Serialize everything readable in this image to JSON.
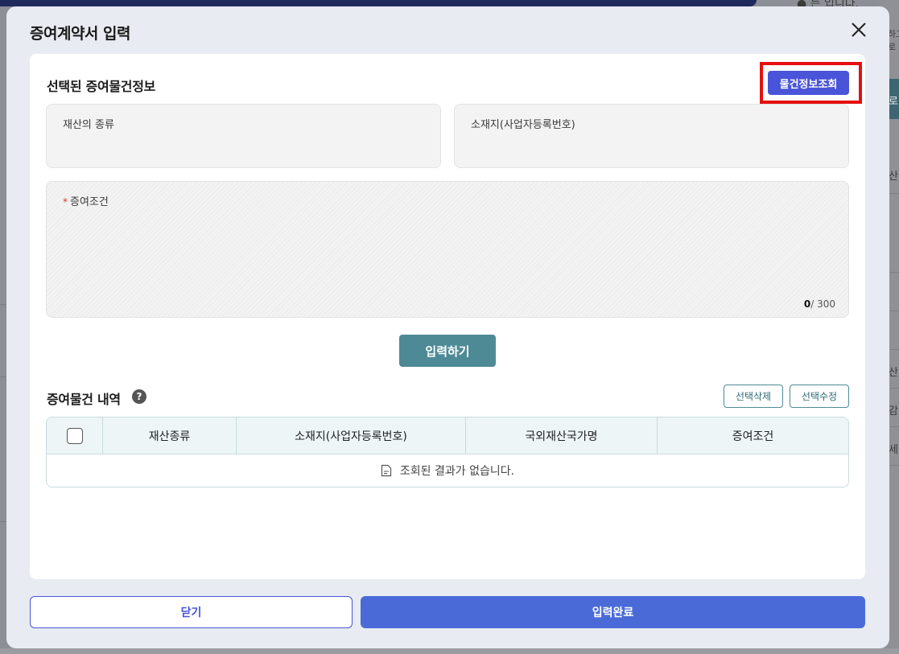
{
  "background": {
    "fragments": [
      "● 는 입니다.",
      "하고",
      "로",
      "로",
      "산",
      "산",
      "감",
      "세"
    ]
  },
  "modal": {
    "title": "증여계약서 입력",
    "section_title": "선택된 증여물건정보",
    "lookup_button": "물건정보조회",
    "fields": {
      "property_type_label": "재산의 종류",
      "location_label": "소재지(사업자등록번호)",
      "condition_required_mark": "*",
      "condition_label": "증여조건",
      "counter_current": "0",
      "counter_max": "/ 300"
    },
    "input_button": "입력하기",
    "list_section_title": "증여물건 내역",
    "help_icon_glyph": "?",
    "delete_selected_button": "선택삭제",
    "edit_selected_button": "선택수정",
    "table": {
      "columns": [
        "재산종류",
        "소재지(사업자등록번호)",
        "국외재산국가명",
        "증여조건"
      ],
      "empty_message": "조회된 결과가 없습니다."
    },
    "footer": {
      "close_button": "닫기",
      "complete_button": "입력완료"
    }
  },
  "colors": {
    "primary": "#4a54d8",
    "teal": "#4e8a96",
    "highlight_border": "#e60f0f"
  }
}
